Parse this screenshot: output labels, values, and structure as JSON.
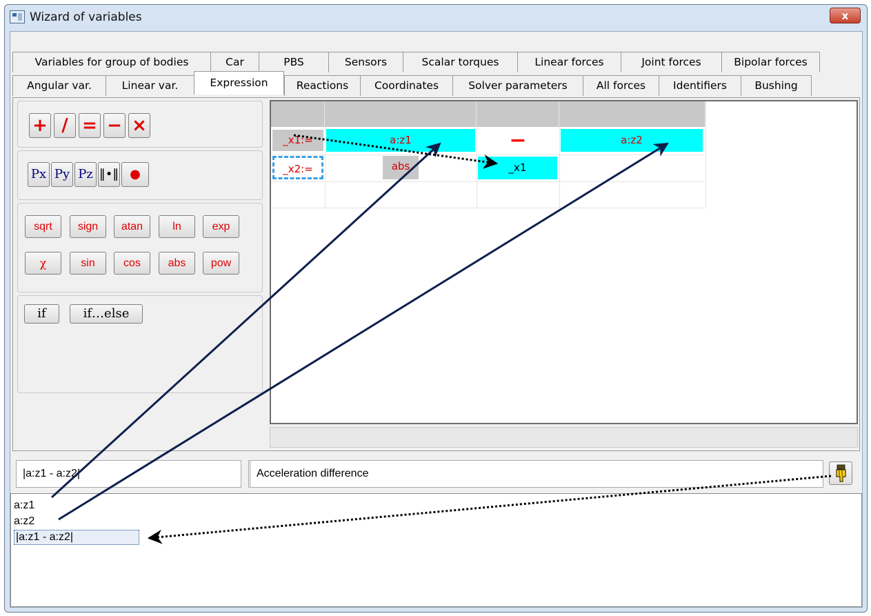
{
  "window": {
    "title": "Wizard of variables",
    "close_label": "x"
  },
  "tabs": {
    "row1": [
      "Variables for group of bodies",
      "Car",
      "PBS",
      "Sensors",
      "Scalar torques",
      "Linear forces",
      "Joint forces",
      "Bipolar forces"
    ],
    "row2": [
      "Angular var.",
      "Linear var.",
      "Expression",
      "Reactions",
      "Coordinates",
      "Solver parameters",
      "All forces",
      "Identifiers",
      "Bushing"
    ],
    "active": "Expression"
  },
  "operators": [
    "+",
    "/",
    "=",
    "−",
    "×"
  ],
  "vector_ops": [
    "Px",
    "Py",
    "Pz",
    "‖•‖",
    "●"
  ],
  "functions_row1": [
    "sqrt",
    "sign",
    "atan",
    "ln",
    "exp"
  ],
  "functions_row2": [
    "χ",
    "sin",
    "cos",
    "abs",
    "pow"
  ],
  "conditions": [
    "if",
    "if…else"
  ],
  "grid": {
    "row1": {
      "target": "_x1:=",
      "arg1": "a:z1",
      "operator": "−",
      "arg2": "a:z2"
    },
    "row2": {
      "target": "_x2:=",
      "func": "abs",
      "arg": "_x1"
    }
  },
  "expression_field": "|a:z1 - a:z2|",
  "description_field": "Acceleration difference",
  "variables_list": [
    "a:z1",
    "a:z2",
    "|a:z1 - a:z2|"
  ],
  "colors": {
    "cyan_cell": "#00ffff",
    "arrow": "#0f1f4d",
    "operator_text": "#e00000",
    "window_frame": "#d5e3f2"
  }
}
